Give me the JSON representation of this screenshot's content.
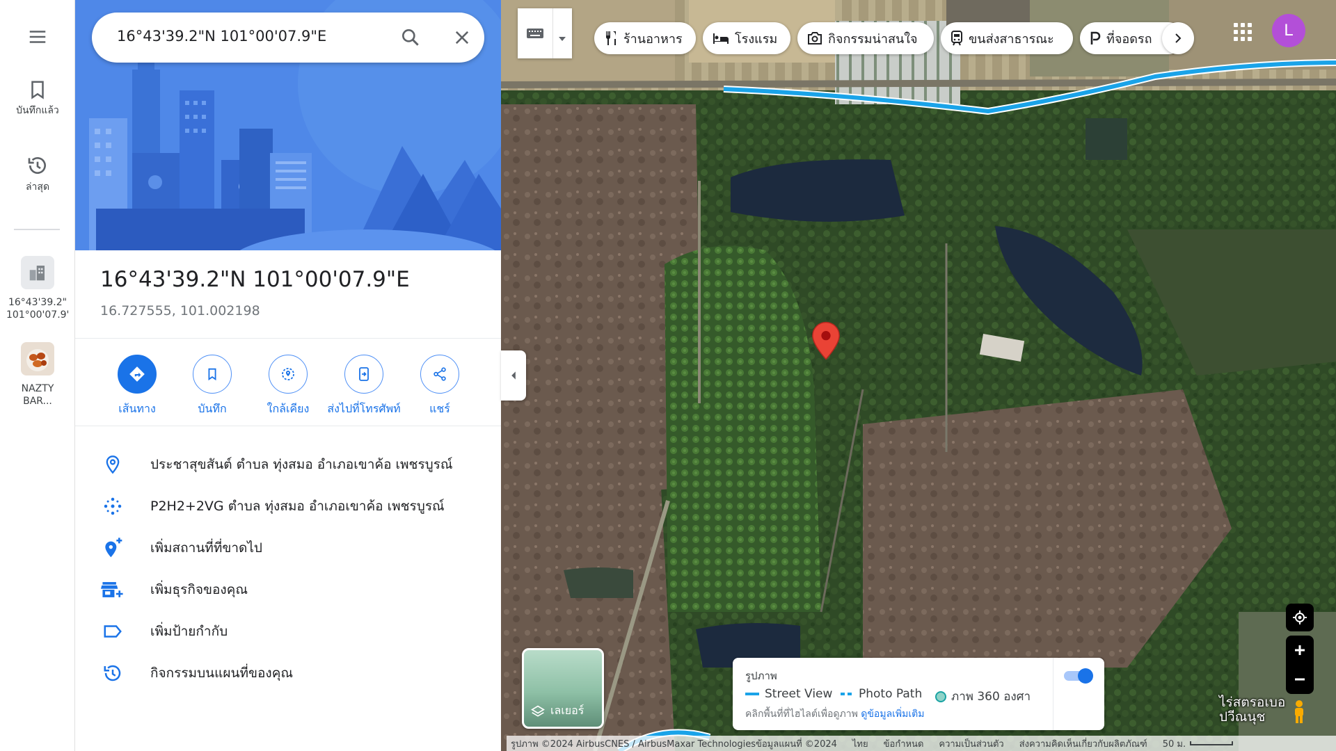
{
  "rail": {
    "saved_label": "บันทึกแล้ว",
    "recent_label": "ล่าสุด",
    "recent_items": [
      {
        "line1": "16°43'39.2\"",
        "line2": "101°00'07.9\"E"
      },
      {
        "line1": "NAZTY",
        "line2": "BAR..."
      }
    ]
  },
  "search": {
    "value": "16°43'39.2\"N 101°00'07.9\"E"
  },
  "place": {
    "title": "16°43'39.2\"N 101°00'07.9\"E",
    "decimal": "16.727555, 101.002198"
  },
  "actions": [
    {
      "label": "เส้นทาง",
      "icon": "directions-icon"
    },
    {
      "label": "บันทึก",
      "icon": "bookmark-icon"
    },
    {
      "label": "ใกล้เคียง",
      "icon": "nearby-icon"
    },
    {
      "label": "ส่งไปที่โทรศัพท์",
      "icon": "send-to-phone-icon"
    },
    {
      "label": "แชร์",
      "icon": "share-icon"
    }
  ],
  "info_rows": [
    {
      "text": "ประชาสุขสันต์ ตำบล ทุ่งสมอ อำเภอเขาค้อ เพชรบูรณ์",
      "icon": "location-pin-icon"
    },
    {
      "text": "P2H2+2VG ตำบล ทุ่งสมอ อำเภอเขาค้อ เพชรบูรณ์",
      "icon": "plus-code-icon"
    },
    {
      "text": "เพิ่มสถานที่ที่ขาดไป",
      "icon": "add-place-icon"
    },
    {
      "text": "เพิ่มธุรกิจของคุณ",
      "icon": "add-business-icon"
    },
    {
      "text": "เพิ่มป้ายกำกับ",
      "icon": "label-icon"
    },
    {
      "text": "กิจกรรมบนแผนที่ของคุณ",
      "icon": "history-icon"
    }
  ],
  "chips": [
    {
      "label": "ร้านอาหาร",
      "icon": "restaurant-icon"
    },
    {
      "label": "โรงแรม",
      "icon": "hotel-icon"
    },
    {
      "label": "กิจกรรมน่าสนใจ",
      "icon": "camera-icon"
    },
    {
      "label": "ขนส่งสาธารณะ",
      "icon": "transit-icon"
    },
    {
      "label": "ที่จอดรถ",
      "icon": "parking-icon"
    }
  ],
  "avatar_letter": "L",
  "layers_label": "เลเยอร์",
  "legend": {
    "title": "รูปภาพ",
    "items": [
      "Street View",
      "Photo Path",
      "ภาพ 360 องศา"
    ],
    "note": "คลิกพื้นที่ที่ไฮไลต์เพื่อดูภาพ",
    "note_link": "ดูข้อมูลเพิ่มเติม",
    "toggle_on": true
  },
  "poi_label": {
    "line1": "ไร่สตรอเบอ",
    "line2": "ปวีณนุช"
  },
  "footer": {
    "imagery": "รูปภาพ ©2024 AirbusCNES / AirbusMaxar Technologiesข้อมูลแผนที่ ©2024",
    "language": "ไทย",
    "terms": "ข้อกำหนด",
    "privacy": "ความเป็นส่วนตัว",
    "feedback": "ส่งความคิดเห็นเกี่ยวกับผลิตภัณฑ์",
    "scale": "50 ม."
  },
  "colors": {
    "accent": "#1a73e8",
    "pin": "#ea4335",
    "avatar": "#b34fd8",
    "street_view_line": "#1aa3e8"
  }
}
